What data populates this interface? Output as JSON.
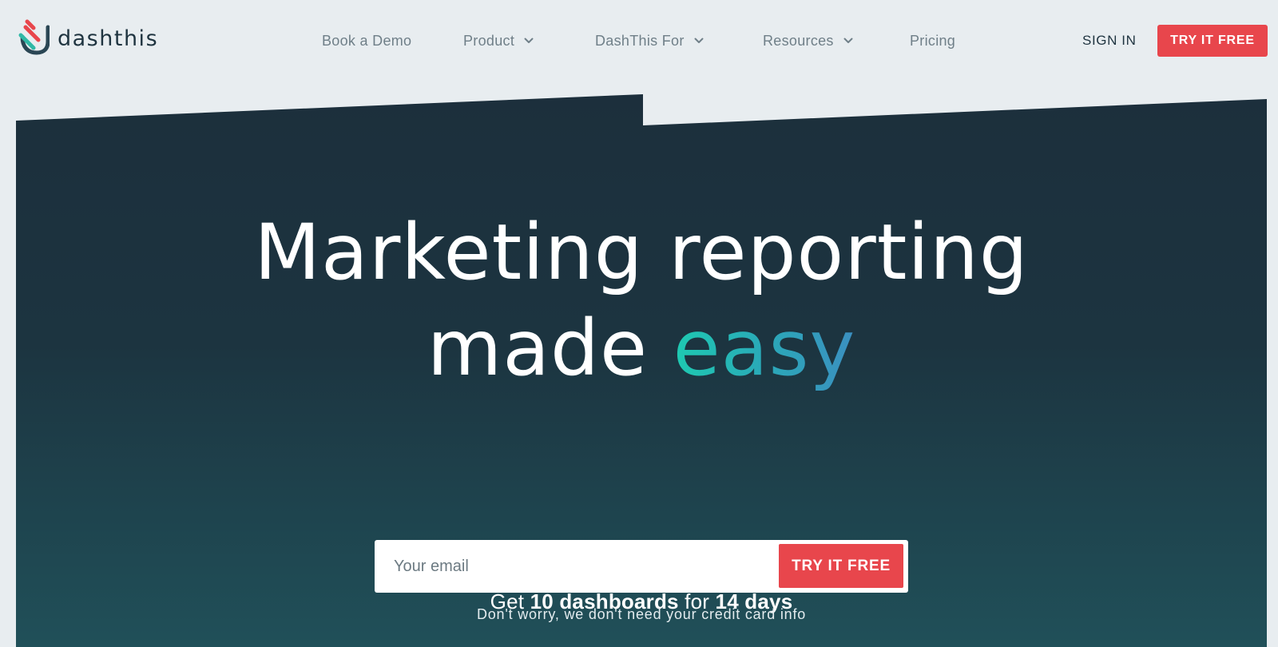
{
  "header": {
    "logo_text": "dashthis",
    "nav": [
      {
        "label": "Book a Demo",
        "has_dropdown": false
      },
      {
        "label": "Product",
        "has_dropdown": true
      },
      {
        "label": "DashThis For",
        "has_dropdown": true
      },
      {
        "label": "Resources",
        "has_dropdown": true
      },
      {
        "label": "Pricing",
        "has_dropdown": false
      }
    ],
    "sign_in": "SIGN IN",
    "try_free": "TRY IT FREE"
  },
  "hero": {
    "headline_line1": "Marketing reporting",
    "headline_line2_plain": "made",
    "headline_line2_accent": "easy",
    "offer": {
      "prefix": "Get",
      "dashboards": "10 dashboards",
      "middle": "for",
      "days": "14 days"
    },
    "email_placeholder": "Your email",
    "cta": "TRY IT FREE",
    "note": "Don't worry, we don't need your credit card info"
  },
  "colors": {
    "background": "#e8edf0",
    "hero_top": "#1c2f3c",
    "hero_bottom": "#205059",
    "cta_red": "#e8464c",
    "accent_teal": "#1ecab1",
    "accent_blue": "#3b8fc0",
    "nav_text": "#6f7f88",
    "dark_text": "#1f3440"
  },
  "icons": {
    "logo": "dashthis-logo-icon",
    "dropdown": "chevron-down-icon"
  }
}
